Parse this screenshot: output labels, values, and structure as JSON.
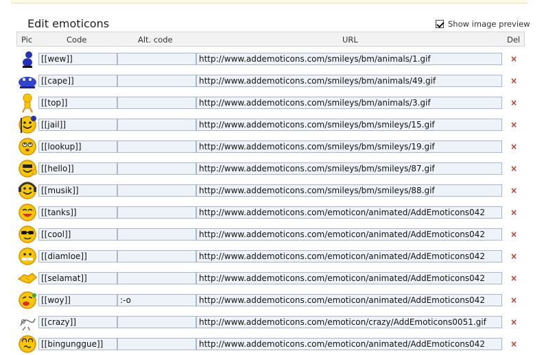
{
  "heading": "Edit emoticons",
  "preview_label": "Show image preview",
  "preview_checked": true,
  "columns": {
    "pic": "Pic",
    "code": "Code",
    "alt": "Alt. code",
    "url": "URL",
    "del": "Del"
  },
  "delete_glyph": "×",
  "colors": {
    "accent_yellow": "#f5c800",
    "field_bg": "#eef3f9",
    "field_border": "#a9b8c8",
    "delete_red": "#cc2b1e"
  },
  "rows": [
    {
      "icon": "blue-animal-icon",
      "code": "[[wew]]",
      "alt": "",
      "url": "http://www.addemoticons.com/smileys/bm/animals/1.gif"
    },
    {
      "icon": "blue-creature-icon",
      "code": "[[cape]]",
      "alt": "",
      "url": "http://www.addemoticons.com/smileys/bm/animals/49.gif"
    },
    {
      "icon": "yellow-dancer-icon",
      "code": "[[top]]",
      "alt": "",
      "url": "http://www.addemoticons.com/smileys/bm/animals/3.gif"
    },
    {
      "icon": "jail-smiley-icon",
      "code": "[[jail]]",
      "alt": "",
      "url": "http://www.addemoticons.com/smileys/bm/smileys/15.gif"
    },
    {
      "icon": "lookup-smiley-icon",
      "code": "[[lookup]]",
      "alt": "",
      "url": "http://www.addemoticons.com/smileys/bm/smileys/19.gif"
    },
    {
      "icon": "hello-smiley-icon",
      "code": "[[hello]]",
      "alt": "",
      "url": "http://www.addemoticons.com/smileys/bm/smileys/87.gif"
    },
    {
      "icon": "music-smiley-icon",
      "code": "[[musik]]",
      "alt": "",
      "url": "http://www.addemoticons.com/smileys/bm/smileys/88.gif"
    },
    {
      "icon": "thanks-smiley-icon",
      "code": "[[tanks]]",
      "alt": "",
      "url": "http://www.addemoticons.com/emoticon/animated/AddEmoticons042"
    },
    {
      "icon": "cool-smiley-icon",
      "code": "[[cool]]",
      "alt": "",
      "url": "http://www.addemoticons.com/emoticon/animated/AddEmoticons042"
    },
    {
      "icon": "silent-smiley-icon",
      "code": "[[diamloe]]",
      "alt": "",
      "url": "http://www.addemoticons.com/emoticon/animated/AddEmoticons042"
    },
    {
      "icon": "handshake-icon",
      "code": "[[selamat]]",
      "alt": "",
      "url": "http://www.addemoticons.com/emoticon/animated/AddEmoticons042"
    },
    {
      "icon": "tongue-smiley-icon",
      "code": "[[woy]]",
      "alt": ":-o",
      "url": "http://www.addemoticons.com/emoticon/animated/AddEmoticons042"
    },
    {
      "icon": "crazy-doodle-icon",
      "code": "[[crazy]]",
      "alt": "",
      "url": "http://www.addemoticons.com/emoticon/crazy/AddEmoticons0051.gif"
    },
    {
      "icon": "dizzy-smiley-icon",
      "code": "[[bingunggue]]",
      "alt": "",
      "url": "http://www.addemoticons.com/emoticon/animated/AddEmoticons042"
    }
  ]
}
